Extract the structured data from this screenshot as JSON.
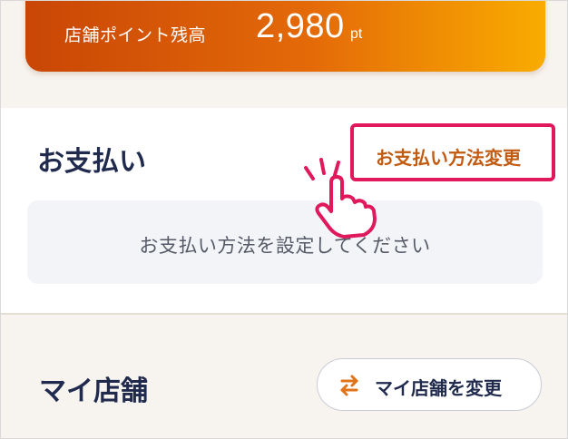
{
  "points": {
    "label": "店舗ポイント残高",
    "value": "2,980",
    "unit": "pt"
  },
  "payment": {
    "title": "お支払い",
    "change_link": "お支払い方法変更",
    "placeholder": "お支払い方法を設定してください"
  },
  "store": {
    "title": "マイ店舗",
    "change_button": "マイ店舗を変更"
  },
  "icons": {
    "pointer": "hand-pointer-icon",
    "swap": "swap-arrows-icon"
  },
  "colors": {
    "accent_orange": "#c25a10",
    "highlight_pink": "#e0195d",
    "gradient_start": "#c94606",
    "gradient_end": "#f9ac00",
    "navy_text": "#1f2a4d"
  }
}
